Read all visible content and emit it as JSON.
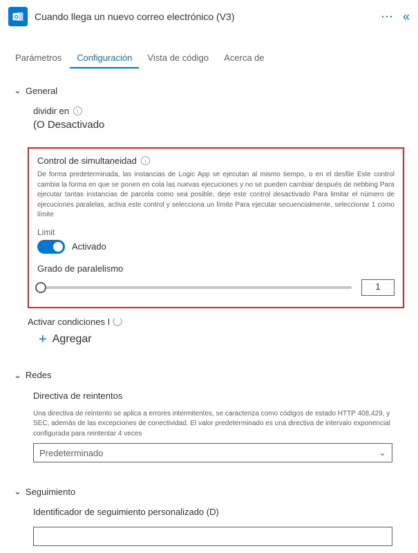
{
  "header": {
    "title": "Cuando llega un nuevo correo electrónico (V3)"
  },
  "tabs": {
    "parametros": "Parámetros",
    "configuracion": "Configuración",
    "vistaCodigo": "Vista de código",
    "acercaDe": "Acerca de"
  },
  "sections": {
    "general": {
      "title": "General",
      "splitOn": {
        "label": "dividir en",
        "value": "(O Desactivado"
      },
      "concurrency": {
        "title": "Control de simultaneidad",
        "description": "De forma predeterminada, las instancias de Logic App se ejecutan al mismo tiempo, o en el desfile Este control cambia la forma en que se ponen en cola las nuevas ejecuciones y no se pueden cambiar después de nebbing Para ejecutar tantas instancias de parcela como sea posible, deje este control desactivado Para limitar el número de ejecuciones paralelas, activa este control y selecciona un límite Para ejecutar secuencialmente, seleccionar 1 como límite",
        "limitLabel": "Limit",
        "toggleState": "Activado",
        "parallelismLabel": "Grado de paralelismo",
        "parallelismValue": "1"
      },
      "triggerConditions": {
        "label": "Activar condiciones I",
        "addLabel": "Agregar"
      }
    },
    "redes": {
      "title": "Redes",
      "retry": {
        "label": "Directiva de reintentos",
        "description": "Una directiva de reintento se aplica a errores intermitentes, se caracteriza como códigos de estado HTTP 408,429, y SEC, además de las excepciones de conectividad. El valor predeterminado es una directiva de intervalo exponencial configurada para reintentar 4 veces",
        "selected": "Predeterminado"
      }
    },
    "seguimiento": {
      "title": "Seguimiento",
      "trackingId": {
        "label": "Identificador de seguimiento personalizado (D)"
      }
    }
  }
}
